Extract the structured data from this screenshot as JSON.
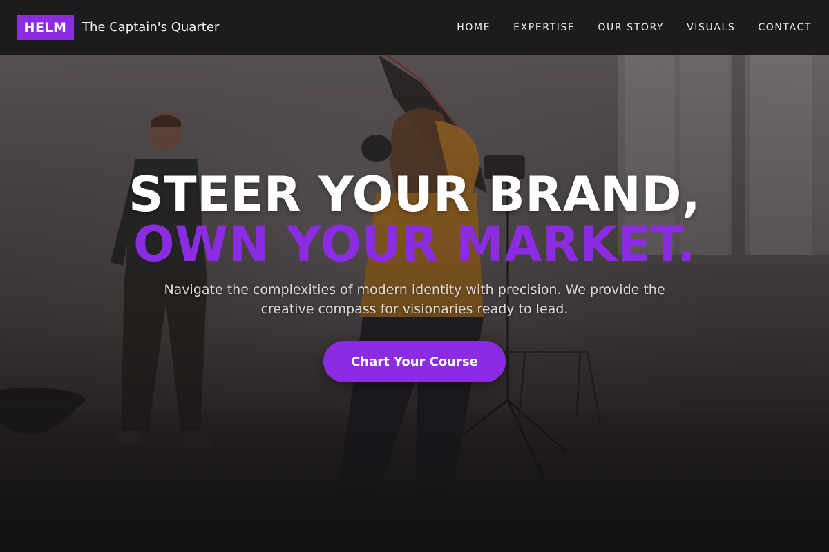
{
  "header": {
    "logo": "HELM",
    "brand_name": "The Captain's Quarter",
    "nav": [
      {
        "label": "HOME"
      },
      {
        "label": "EXPERTISE"
      },
      {
        "label": "OUR STORY"
      },
      {
        "label": "VISUALS"
      },
      {
        "label": "CONTACT"
      }
    ]
  },
  "hero": {
    "headline_line1": "STEER YOUR BRAND,",
    "headline_line2": "OWN YOUR MARKET.",
    "subtitle": "Navigate the complexities of modern identity with precision. We provide the creative compass for visionaries ready to lead.",
    "cta_label": "Chart Your Course",
    "background_image": "photo-studio-shoot"
  },
  "colors": {
    "accent": "#8b2be2",
    "header_bg": "#1c1c1c",
    "headline": "#ffffff",
    "subtitle": "#d9d9d9"
  }
}
